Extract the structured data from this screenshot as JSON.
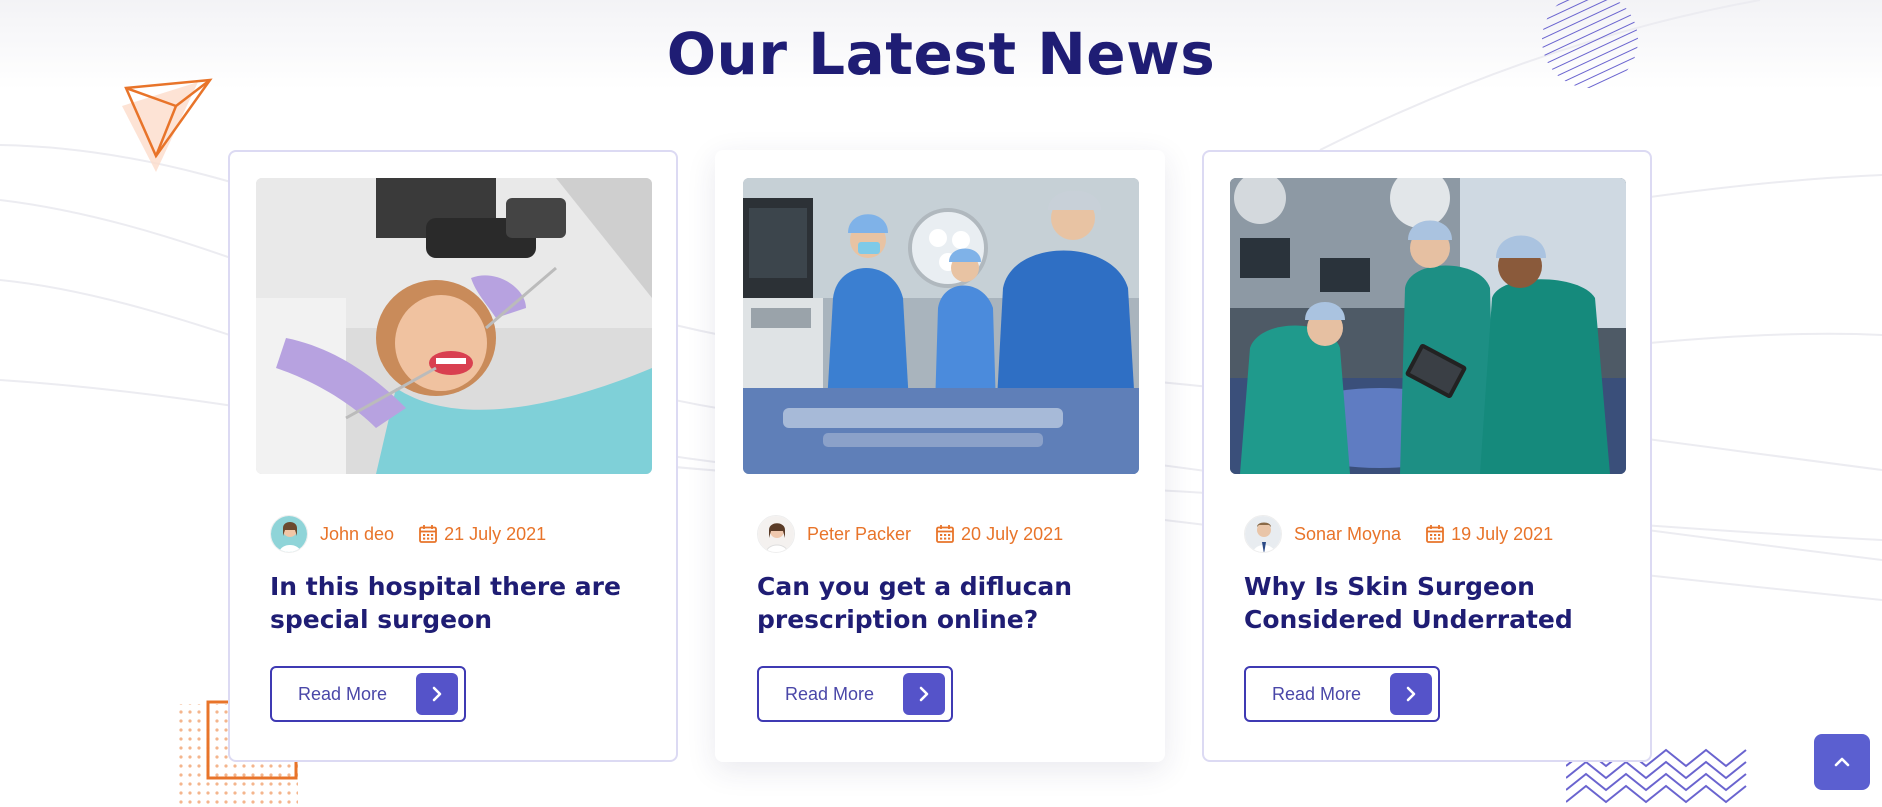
{
  "section": {
    "title": "Our Latest News"
  },
  "colors": {
    "title": "#1f1d74",
    "accent_orange": "#e8742a",
    "button_border": "#3f3ab3",
    "button_arrow_bg": "#5553c9",
    "scroll_top_bg": "#5b5fd0"
  },
  "posts": [
    {
      "author": "John deo",
      "date": "21 July 2021",
      "title": "In this hospital there are special surgeon",
      "read_more": "Read More",
      "image": "dentist-patient-photo"
    },
    {
      "author": "Peter Packer",
      "date": "20 July 2021",
      "title": "Can you get a diflucan prescription online?",
      "read_more": "Read More",
      "image": "surgeons-operating-room-photo"
    },
    {
      "author": "Sonar Moyna",
      "date": "19 July 2021",
      "title": "Why Is Skin Surgeon Considered Underrated",
      "read_more": "Read More",
      "image": "surgery-team-tablet-photo"
    }
  ],
  "icons": {
    "calendar": "calendar-icon",
    "arrow": "chevron-right-icon",
    "scroll_top": "chevron-up-icon"
  }
}
